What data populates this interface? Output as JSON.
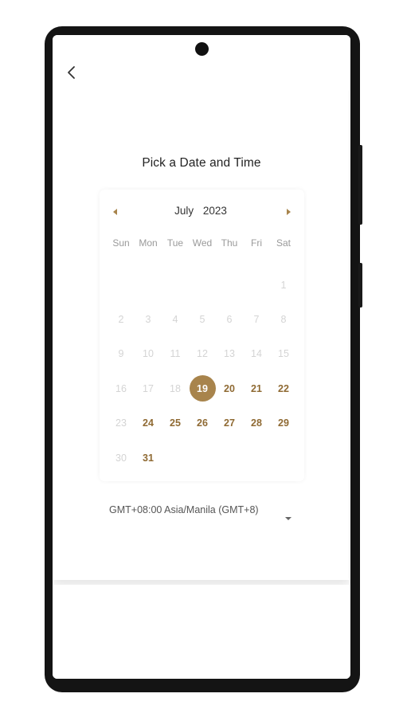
{
  "screen": {
    "title": "Pick a Date and Time"
  },
  "calendar": {
    "month": "July",
    "year": "2023",
    "weekdays": [
      "Sun",
      "Mon",
      "Tue",
      "Wed",
      "Thu",
      "Fri",
      "Sat"
    ],
    "leading_blanks": 6,
    "days": [
      {
        "d": "1",
        "state": "disabled"
      },
      {
        "d": "2",
        "state": "disabled"
      },
      {
        "d": "3",
        "state": "disabled"
      },
      {
        "d": "4",
        "state": "disabled"
      },
      {
        "d": "5",
        "state": "disabled"
      },
      {
        "d": "6",
        "state": "disabled"
      },
      {
        "d": "7",
        "state": "disabled"
      },
      {
        "d": "8",
        "state": "disabled"
      },
      {
        "d": "9",
        "state": "disabled"
      },
      {
        "d": "10",
        "state": "disabled"
      },
      {
        "d": "11",
        "state": "disabled"
      },
      {
        "d": "12",
        "state": "disabled"
      },
      {
        "d": "13",
        "state": "disabled"
      },
      {
        "d": "14",
        "state": "disabled"
      },
      {
        "d": "15",
        "state": "disabled"
      },
      {
        "d": "16",
        "state": "disabled"
      },
      {
        "d": "17",
        "state": "disabled"
      },
      {
        "d": "18",
        "state": "disabled"
      },
      {
        "d": "19",
        "state": "selected"
      },
      {
        "d": "20",
        "state": "available"
      },
      {
        "d": "21",
        "state": "available"
      },
      {
        "d": "22",
        "state": "available"
      },
      {
        "d": "23",
        "state": "disabled"
      },
      {
        "d": "24",
        "state": "available"
      },
      {
        "d": "25",
        "state": "available"
      },
      {
        "d": "26",
        "state": "available"
      },
      {
        "d": "27",
        "state": "available"
      },
      {
        "d": "28",
        "state": "available"
      },
      {
        "d": "29",
        "state": "available"
      },
      {
        "d": "30",
        "state": "disabled"
      },
      {
        "d": "31",
        "state": "available"
      }
    ]
  },
  "timezone": {
    "value": "GMT+08:00 Asia/Manila (GMT+8)"
  },
  "colors": {
    "accent": "#a8844c",
    "available_text": "#8f6a33",
    "disabled_text": "#d4d4d4"
  },
  "icons": {
    "back": "chevron-left-icon",
    "prev": "caret-left-icon",
    "next": "caret-right-icon",
    "dropdown": "caret-down-icon"
  }
}
